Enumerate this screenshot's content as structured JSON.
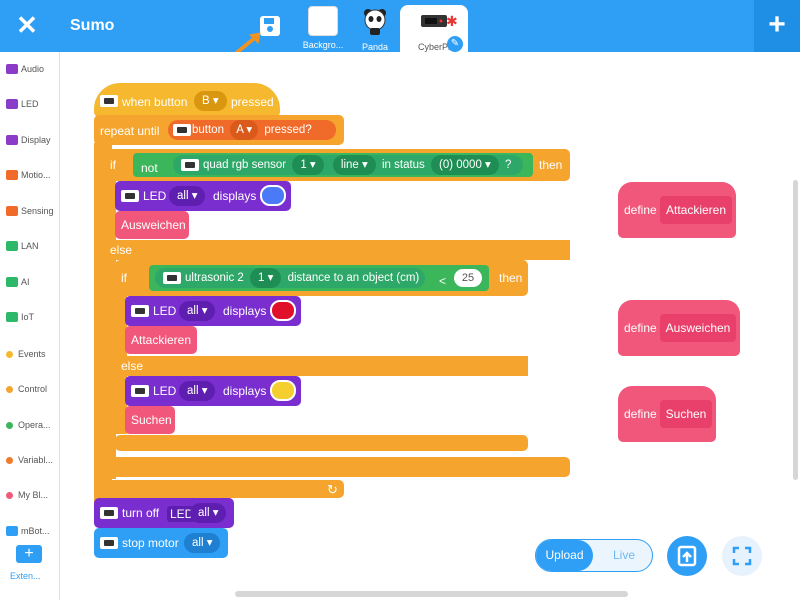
{
  "app": {
    "title": "Sumo"
  },
  "sprites": [
    {
      "label": "Backgro..."
    },
    {
      "label": "Panda"
    },
    {
      "label": "CyberPi"
    }
  ],
  "sidebar": {
    "items": [
      {
        "label": "Audio",
        "icon": "audio-icon",
        "color": "#8a3cc8"
      },
      {
        "label": "LED",
        "icon": "led-icon",
        "color": "#8a3cc8"
      },
      {
        "label": "Display",
        "icon": "display-icon",
        "color": "#8a3cc8"
      },
      {
        "label": "Motio...",
        "icon": "motion-icon",
        "color": "#f06a2a"
      },
      {
        "label": "Sensing",
        "icon": "sensing-icon",
        "color": "#f06a2a"
      },
      {
        "label": "LAN",
        "icon": "lan-icon",
        "color": "#2eb86a"
      },
      {
        "label": "AI",
        "icon": "ai-icon",
        "color": "#2eb86a"
      },
      {
        "label": "IoT",
        "icon": "iot-icon",
        "color": "#2eb86a"
      },
      {
        "label": "Events",
        "icon": "dot",
        "color": "#f5b82e"
      },
      {
        "label": "Control",
        "icon": "dot",
        "color": "#f5a52e"
      },
      {
        "label": "Opera...",
        "icon": "dot",
        "color": "#3cb65a"
      },
      {
        "label": "Variabl...",
        "icon": "dot",
        "color": "#f07a2a"
      },
      {
        "label": "My Bl...",
        "icon": "dot",
        "color": "#ee5a7a"
      },
      {
        "label": "mBot...",
        "icon": "mbot-icon",
        "color": "#2f9ff5"
      }
    ],
    "extension_label": "Exten..."
  },
  "blocks": {
    "when_button": "when button",
    "button_b": "B",
    "pressed": "pressed",
    "repeat_until": "repeat until",
    "button": "button",
    "button_a": "A",
    "pressed_q": "pressed?",
    "if": "if",
    "not": "not",
    "quad_rgb": "quad rgb sensor",
    "sensor_num": "1",
    "line": "line",
    "in_status": "in status",
    "status_val": "(0) 0000",
    "q": "?",
    "then": "then",
    "led": "LED",
    "all": "all",
    "displays": "displays",
    "ausweichen": "Ausweichen",
    "else": "else",
    "ultrasonic": "ultrasonic 2",
    "ultra_num": "1",
    "distance": "distance to an object (cm)",
    "lt": "<",
    "dist_val": "25",
    "attackieren": "Attackieren",
    "suchen": "Suchen",
    "turn_off": "turn off",
    "stop_motor": "stop motor",
    "define": "define",
    "repeat_arrow": "↻"
  },
  "colors": {
    "topbar": "#2f9ff5",
    "events": "#f5b82e",
    "control": "#f5a52e",
    "sensing": "#f06a2a",
    "sensing_green": "#2ea868",
    "led": "#7a2ed0",
    "myblocks": "#f0577a",
    "mbot": "#2f9ff5",
    "led_blue": "#4a7af5",
    "led_red": "#e0102a",
    "led_yellow": "#f5cf30"
  },
  "controls": {
    "upload": "Upload",
    "live": "Live"
  }
}
